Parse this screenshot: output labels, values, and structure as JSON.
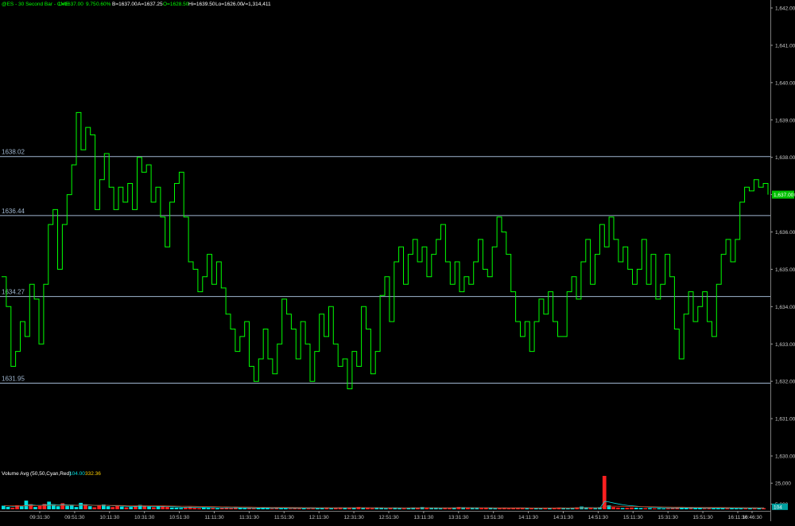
{
  "header": {
    "symbol": "@ES - 30 Second Bar - CME",
    "last": "L=1637.00",
    "change": "9.75",
    "pct": "0.60%",
    "bid": "B=1637.00",
    "ask": "A=1637.25",
    "open": "O=1628.50",
    "high": "Hi=1639.50",
    "low": "Lo=1626.00",
    "volume": "V=1,314,411"
  },
  "colors": {
    "background": "#000000",
    "price_line": "#00ff00",
    "level_line": "#9fb6cf",
    "header_text": "#00ff00",
    "axis_text": "#c8c8c8",
    "volume_up": "#00e0e0",
    "volume_down": "#ff2020",
    "avg_fast": "#00e0e0",
    "avg_slow": "#d04020",
    "last_tag_bg": "#00c000"
  },
  "chart_data": {
    "type": "line",
    "price_axis": {
      "ylim": [
        1629.7,
        1642.2
      ],
      "ticks": [
        "1,642.00",
        "1,641.00",
        "1,640.00",
        "1,639.00",
        "1,638.00",
        "1,637.00",
        "1,636.00",
        "1,635.00",
        "1,634.00",
        "1,633.00",
        "1,632.00",
        "1,631.00",
        "1,630.00"
      ],
      "tick_values": [
        1642,
        1641,
        1640,
        1639,
        1638,
        1637,
        1636,
        1635,
        1634,
        1633,
        1632,
        1631,
        1630
      ]
    },
    "last_price_label": "1,637.00",
    "last_price": 1637.0,
    "levels": [
      {
        "label": "1638.02",
        "value": 1638.02
      },
      {
        "label": "1636.44",
        "value": 1636.44
      },
      {
        "label": "1634.27",
        "value": 1634.27
      },
      {
        "label": "1631.95",
        "value": 1631.95
      }
    ],
    "x_ticks": [
      "09:31:30",
      "09:51:30",
      "10:11:30",
      "10:31:30",
      "10:51:30",
      "11:11:30",
      "11:31:30",
      "11:51:30",
      "12:11:30",
      "12:31:30",
      "12:51:30",
      "13:11:30",
      "13:31:30",
      "13:51:30",
      "14:11:30",
      "14:31:30",
      "14:51:30",
      "15:11:30",
      "15:31:30",
      "15:51:30",
      "16:11:30",
      "16:46:30"
    ],
    "series": [
      {
        "values": [
          1634.8,
          1634.0,
          1632.4,
          1632.8,
          1633.6,
          1633.2,
          1634.6,
          1634.2,
          1633.0,
          1634.6,
          1636.2,
          1636.6,
          1635.0,
          1636.2,
          1637.0,
          1637.8,
          1639.2,
          1638.2,
          1638.8,
          1638.6,
          1636.6,
          1637.4,
          1638.1,
          1637.2,
          1636.6,
          1637.2,
          1636.8,
          1637.3,
          1636.6,
          1638.0,
          1637.6,
          1637.8,
          1636.8,
          1637.2,
          1636.4,
          1635.6,
          1636.8,
          1637.3,
          1637.6,
          1636.4,
          1635.2,
          1635.0,
          1634.4,
          1634.8,
          1635.4,
          1634.6,
          1635.2,
          1634.5,
          1633.8,
          1633.4,
          1632.8,
          1633.2,
          1633.6,
          1632.4,
          1632.0,
          1632.6,
          1633.4,
          1632.6,
          1632.2,
          1633.0,
          1634.2,
          1633.8,
          1633.4,
          1632.6,
          1633.6,
          1633.0,
          1632.0,
          1632.8,
          1633.8,
          1633.2,
          1634.0,
          1633.0,
          1632.4,
          1632.6,
          1631.8,
          1632.8,
          1632.4,
          1634.0,
          1633.4,
          1632.2,
          1632.8,
          1634.3,
          1634.8,
          1633.6,
          1635.2,
          1635.6,
          1634.6,
          1635.4,
          1635.8,
          1635.2,
          1635.6,
          1634.8,
          1635.4,
          1635.8,
          1636.2,
          1635.2,
          1634.6,
          1635.2,
          1634.4,
          1634.8,
          1634.6,
          1635.2,
          1635.8,
          1635.0,
          1634.8,
          1635.6,
          1636.4,
          1636.0,
          1635.4,
          1634.4,
          1633.6,
          1633.2,
          1633.6,
          1632.8,
          1633.6,
          1634.2,
          1633.8,
          1634.4,
          1633.6,
          1633.2,
          1633.2,
          1634.4,
          1634.8,
          1634.2,
          1635.2,
          1635.8,
          1634.6,
          1635.4,
          1636.2,
          1635.6,
          1636.4,
          1635.8,
          1635.2,
          1635.6,
          1635.0,
          1634.6,
          1635.0,
          1635.8,
          1634.6,
          1635.4,
          1634.2,
          1634.6,
          1635.4,
          1634.8,
          1633.4,
          1632.6,
          1633.8,
          1634.4,
          1633.6,
          1634.0,
          1634.4,
          1633.6,
          1633.2,
          1634.6,
          1635.4,
          1635.8,
          1635.2,
          1635.8,
          1636.8,
          1637.2,
          1637.1,
          1637.4,
          1637.2,
          1637.3,
          1637.0
        ]
      }
    ],
    "volume_panel": {
      "label": "Volume Avg (50,50,Cyan,Red)",
      "value_fast": "104.00",
      "value_slow": "332.36",
      "ylim": [
        0,
        32000
      ],
      "ticks": [
        "25,000",
        "5,000"
      ],
      "tick_values": [
        25000,
        5000
      ],
      "last_label": "104",
      "last_value": 104,
      "values": [
        3400,
        2300,
        1500,
        3900,
        2900,
        8300,
        4900,
        2200,
        3300,
        5100,
        7300,
        4100,
        2900,
        5800,
        3300,
        3800,
        2200,
        6200,
        4800,
        3000,
        1900,
        3700,
        4600,
        2900,
        2100,
        3400,
        2600,
        1800,
        2200,
        3000,
        4100,
        2700,
        2500,
        1900,
        2800,
        3100,
        2200,
        1700,
        1500,
        1300,
        1600,
        2200,
        1400,
        1100,
        1800,
        1400,
        1200,
        900,
        1400,
        1700,
        1100,
        1800,
        1300,
        1000,
        1200,
        900,
        1300,
        1600,
        1100,
        800,
        1200,
        900,
        1100,
        700,
        1400,
        1000,
        800,
        1200,
        900,
        1300,
        1600,
        1800,
        1000,
        1400,
        1900,
        1200,
        1300,
        1700,
        2200,
        1400,
        1300,
        1000,
        1800,
        1200,
        900,
        1200,
        1600,
        1100,
        900,
        1300,
        1700,
        1200,
        2100,
        1500,
        1300,
        1200,
        1000,
        1400,
        1100,
        1600,
        2200,
        2000,
        1500,
        1300,
        1400,
        1100,
        1200,
        1300,
        900,
        1100,
        1400,
        1000,
        1300,
        1500,
        1200,
        1100,
        900,
        1200,
        1000,
        1200,
        1500,
        1100,
        1700,
        1300,
        1000,
        1400,
        1900,
        2600,
        1800,
        1400,
        1100,
        2000,
        32000,
        3800,
        2100,
        1600,
        1200,
        1400,
        1700,
        1500,
        1300,
        1100,
        1200,
        900,
        1000,
        800,
        900,
        1100,
        1600,
        1300,
        1200,
        1400,
        1000,
        1100,
        900,
        1200,
        1000,
        1100,
        1300,
        1000,
        1200,
        900,
        1100,
        800,
        1000,
        1200,
        900,
        1100
      ]
    }
  }
}
